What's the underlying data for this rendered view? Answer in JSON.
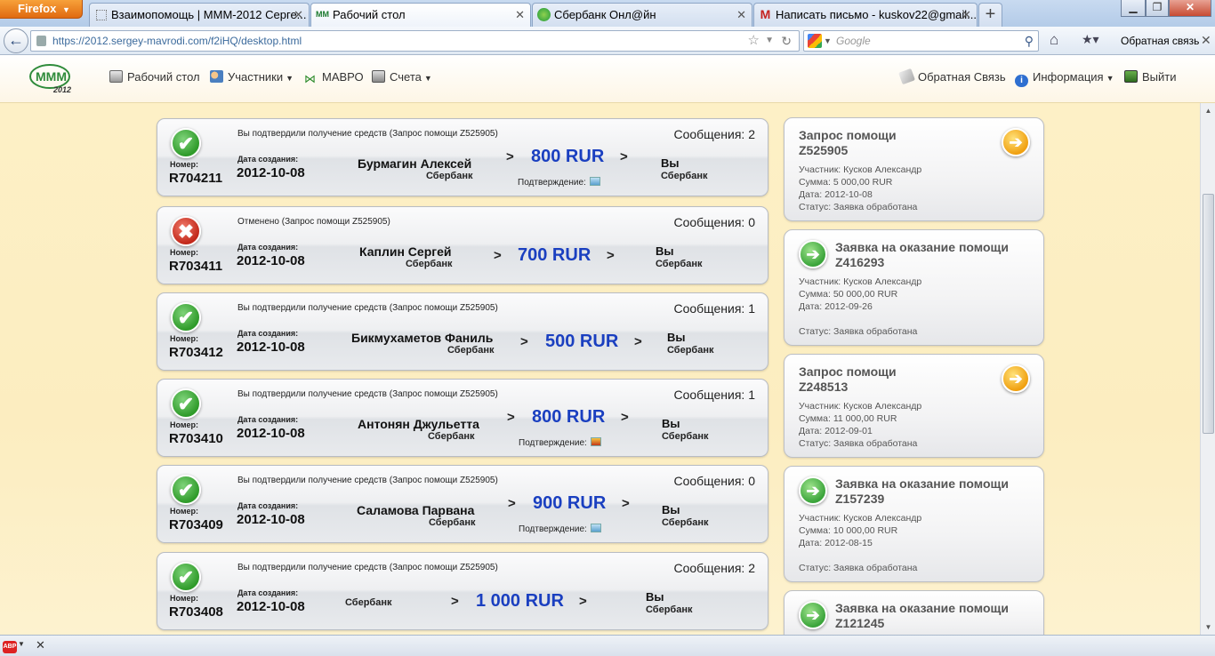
{
  "browser": {
    "firefox_label": "Firefox",
    "tabs": [
      {
        "title": "Взаимопомощь | МММ-2012 Серге...",
        "icon": "blank-page-icon"
      },
      {
        "title": "Рабочий стол",
        "icon": "mmm-icon"
      },
      {
        "title": "Сбербанк Онл@йн",
        "icon": "sberbank-icon"
      },
      {
        "title": "Написать письмо - kuskov22@gmail...",
        "icon": "gmail-icon"
      }
    ],
    "url": "https://2012.sergey-mavrodi.com/f2iHQ/desktop.html",
    "search_placeholder": "Google",
    "feedback_label": "Обратная связь"
  },
  "site": {
    "logo_text": "2012",
    "menu": {
      "desktop": "Рабочий стол",
      "participants": "Участники",
      "mavro": "МАВРО",
      "accounts": "Счета",
      "feedback": "Обратная Связь",
      "info": "Информация",
      "logout": "Выйти"
    }
  },
  "labels": {
    "number": "Номер:",
    "created": "Дата создания:",
    "confirmation": "Подтверждение:",
    "you": "Вы",
    "gt": ">"
  },
  "transactions": [
    {
      "status": "ok",
      "note": "Вы подтвердили получение средств (Запрос помощи Z525905)",
      "messages": "Сообщения: 2",
      "number": "R704211",
      "date": "2012-10-08",
      "name": "Бурмагин Алексей",
      "bank": "Сбербанк",
      "amount": "800 RUR",
      "you_bank": "Сбербанк",
      "confirmation": true,
      "conf_icon": "image-icon"
    },
    {
      "status": "no",
      "note": "Отменено (Запрос помощи Z525905)",
      "messages": "Сообщения: 0",
      "number": "R703411",
      "date": "2012-10-08",
      "name": "Каплин Сергей",
      "bank": "Сбербанк",
      "amount": "700 RUR",
      "you_bank": "Сбербанк",
      "confirmation": false
    },
    {
      "status": "ok",
      "note": "Вы подтвердили получение средств (Запрос помощи Z525905)",
      "messages": "Сообщения: 1",
      "number": "R703412",
      "date": "2012-10-08",
      "name": "Бикмухаметов Фаниль",
      "bank": "Сбербанк",
      "amount": "500 RUR",
      "you_bank": "Сбербанк",
      "confirmation": false
    },
    {
      "status": "ok",
      "note": "Вы подтвердили получение средств (Запрос помощи Z525905)",
      "messages": "Сообщения: 1",
      "number": "R703410",
      "date": "2012-10-08",
      "name": "Антонян Джульетта",
      "bank": "Сбербанк",
      "amount": "800 RUR",
      "you_bank": "Сбербанк",
      "confirmation": true,
      "conf_icon": "photo-icon"
    },
    {
      "status": "ok",
      "note": "Вы подтвердили получение средств (Запрос помощи Z525905)",
      "messages": "Сообщения: 0",
      "number": "R703409",
      "date": "2012-10-08",
      "name": "Саламова Парвана",
      "bank": "Сбербанк",
      "amount": "900 RUR",
      "you_bank": "Сбербанк",
      "confirmation": true,
      "conf_icon": "image-icon"
    },
    {
      "status": "ok",
      "note": "Вы подтвердили получение средств (Запрос помощи Z525905)",
      "messages": "Сообщения: 2",
      "number": "R703408",
      "date": "2012-10-08",
      "name": "",
      "bank": "Сбербанк",
      "amount": "1 000 RUR",
      "you_bank": "Сбербанк",
      "confirmation": false
    }
  ],
  "requests": [
    {
      "kind": "help_request",
      "title": "Запрос помощи",
      "code": "Z525905",
      "participant": "Участник: Кусков Александр",
      "sum": "Сумма: 5 000,00 RUR",
      "date": "Дата: 2012-10-08",
      "status": "Статус: Заявка обработана"
    },
    {
      "kind": "help_offer",
      "title": "Заявка на оказание помощи",
      "code": "Z416293",
      "participant": "Участник: Кусков Александр",
      "sum": "Сумма: 50 000,00 RUR",
      "date": "Дата: 2012-09-26",
      "status": "Статус: Заявка обработана"
    },
    {
      "kind": "help_request",
      "title": "Запрос помощи",
      "code": "Z248513",
      "participant": "Участник: Кусков Александр",
      "sum": "Сумма: 11 000,00 RUR",
      "date": "Дата: 2012-09-01",
      "status": "Статус: Заявка обработана"
    },
    {
      "kind": "help_offer",
      "title": "Заявка на оказание помощи",
      "code": "Z157239",
      "participant": "Участник: Кусков Александр",
      "sum": "Сумма: 10 000,00 RUR",
      "date": "Дата: 2012-08-15",
      "status": "Статус: Заявка обработана"
    },
    {
      "kind": "help_offer",
      "title": "Заявка на оказание помощи",
      "code": "Z121245",
      "participant": "",
      "sum": "",
      "date": "",
      "status": ""
    }
  ],
  "statusbar": {
    "abp_label": "ABP"
  },
  "colors": {
    "amount": "#1a3fc0",
    "background": "#fcedc0",
    "ok": "#2f9b2a",
    "cancel": "#c2281a",
    "orange_arrow": "#f0a010"
  }
}
